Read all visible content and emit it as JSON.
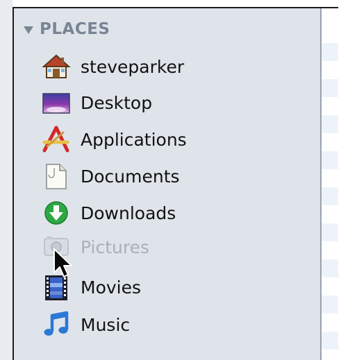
{
  "sidebar": {
    "section_title": "PLACES",
    "items": [
      {
        "label": "steveparker",
        "icon": "home-icon"
      },
      {
        "label": "Desktop",
        "icon": "desktop-icon"
      },
      {
        "label": "Applications",
        "icon": "applications-icon"
      },
      {
        "label": "Documents",
        "icon": "documents-icon"
      },
      {
        "label": "Downloads",
        "icon": "downloads-icon"
      },
      {
        "label": "Pictures",
        "icon": "pictures-icon",
        "state": "dimmed"
      },
      {
        "label": "Movies",
        "icon": "movies-icon"
      },
      {
        "label": "Music",
        "icon": "music-icon"
      }
    ]
  },
  "colors": {
    "sidebar_bg": "#dfe4ea",
    "section_header": "#7a8594",
    "item_text": "#111111",
    "dimmed_text": "#a9b0b8"
  }
}
